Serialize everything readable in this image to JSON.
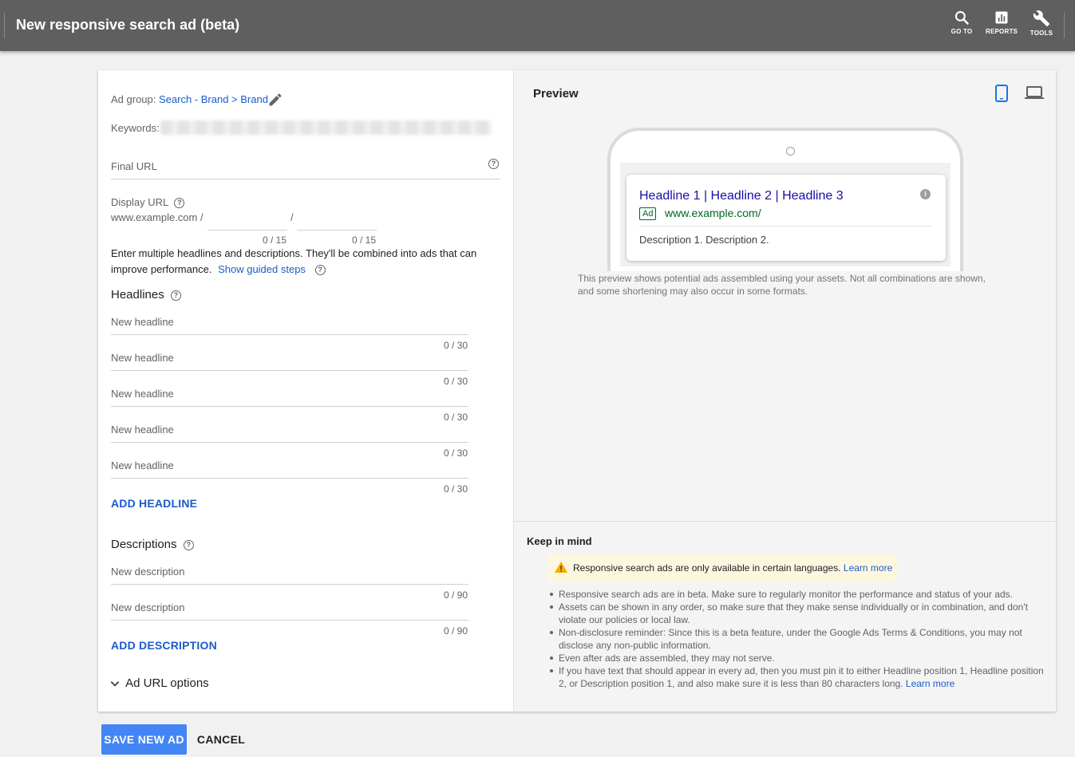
{
  "header": {
    "title": "New responsive search ad (beta)",
    "tools": [
      {
        "label": "GO TO",
        "icon": "search-icon"
      },
      {
        "label": "REPORTS",
        "icon": "reports-icon"
      },
      {
        "label": "TOOLS",
        "icon": "wrench-icon"
      }
    ]
  },
  "form": {
    "ad_group_label": "Ad group:",
    "ad_group_value": "Search - Brand > Brand",
    "keywords_label": "Keywords:",
    "final_url_label": "Final URL",
    "display_url_label": "Display URL",
    "display_url_base": "www.example.com /",
    "display_url_slash": "/",
    "path1_counter": "0 / 15",
    "path2_counter": "0 / 15",
    "instructions": "Enter multiple headlines and descriptions. They'll be combined into ads that can improve performance.",
    "guided_steps_link": "Show guided steps",
    "headlines_title": "Headlines",
    "headlines": [
      {
        "placeholder": "New headline",
        "counter": "0 / 30"
      },
      {
        "placeholder": "New headline",
        "counter": "0 / 30"
      },
      {
        "placeholder": "New headline",
        "counter": "0 / 30"
      },
      {
        "placeholder": "New headline",
        "counter": "0 / 30"
      },
      {
        "placeholder": "New headline",
        "counter": "0 / 30"
      }
    ],
    "add_headline": "ADD HEADLINE",
    "descriptions_title": "Descriptions",
    "descriptions": [
      {
        "placeholder": "New description",
        "counter": "0 / 90"
      },
      {
        "placeholder": "New description",
        "counter": "0 / 90"
      }
    ],
    "add_description": "ADD DESCRIPTION",
    "ad_url_options": "Ad URL options"
  },
  "preview": {
    "title": "Preview",
    "ad_headline": "Headline 1 | Headline 2 | Headline 3",
    "ad_badge": "Ad",
    "ad_url": "www.example.com/",
    "ad_description": "Description 1. Description 2.",
    "note": "This preview shows potential ads assembled using your assets. Not all combinations are shown, and some shortening may also occur in some formats."
  },
  "keep_in_mind": {
    "title": "Keep in mind",
    "warning_text": "Responsive search ads are only available in certain languages.",
    "warning_link": "Learn more",
    "bullets": [
      "Responsive search ads are in beta. Make sure to regularly monitor the performance and status of your ads.",
      "Assets can be shown in any order, so make sure that they make sense individually or in combination, and don't violate our policies or local law.",
      "Non-disclosure reminder: Since this is a beta feature, under the Google Ads Terms & Conditions, you may not disclose any non-public information.",
      "Even after ads are assembled, they may not serve.",
      "If you have text that should appear in every ad, then you must pin it to either Headline position 1, Headline position 2, or Description position 1, and also make sure it is less than 80 characters long."
    ],
    "last_bullet_link": "Learn more"
  },
  "footer": {
    "save_label": "SAVE NEW AD",
    "cancel_label": "CANCEL"
  },
  "colors": {
    "header_bg": "#5f5f5f",
    "link": "#1a5cc9",
    "primary_button": "#4285f4",
    "ad_headline": "#1a0dab",
    "ad_url": "#006621",
    "warning_bg": "#fef7e0"
  }
}
